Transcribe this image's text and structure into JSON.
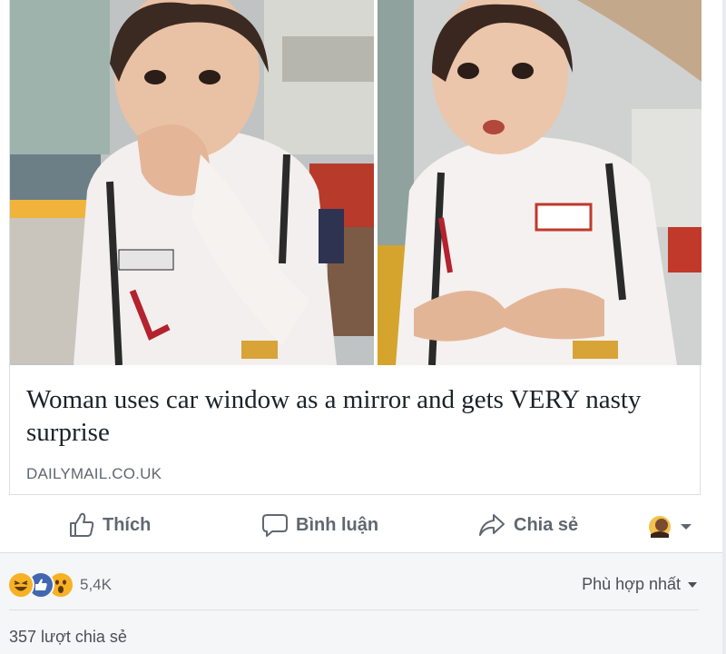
{
  "link_preview": {
    "headline": "Woman uses car window as a mirror and gets VERY nasty surprise",
    "domain": "DAILYMAIL.CO.UK"
  },
  "actions": {
    "like_label": "Thích",
    "comment_label": "Bình luận",
    "share_label": "Chia sẻ"
  },
  "footer": {
    "reaction_count": "5,4K",
    "reaction_icons": [
      "haha-icon",
      "like-icon",
      "wow-icon"
    ],
    "sort_label": "Phù hợp nhất",
    "shares_text": "357 lượt chia sẻ"
  },
  "colors": {
    "facebook_blue": "#4267b2",
    "reaction_yellow": "#f7b125",
    "muted_text": "#606770"
  }
}
